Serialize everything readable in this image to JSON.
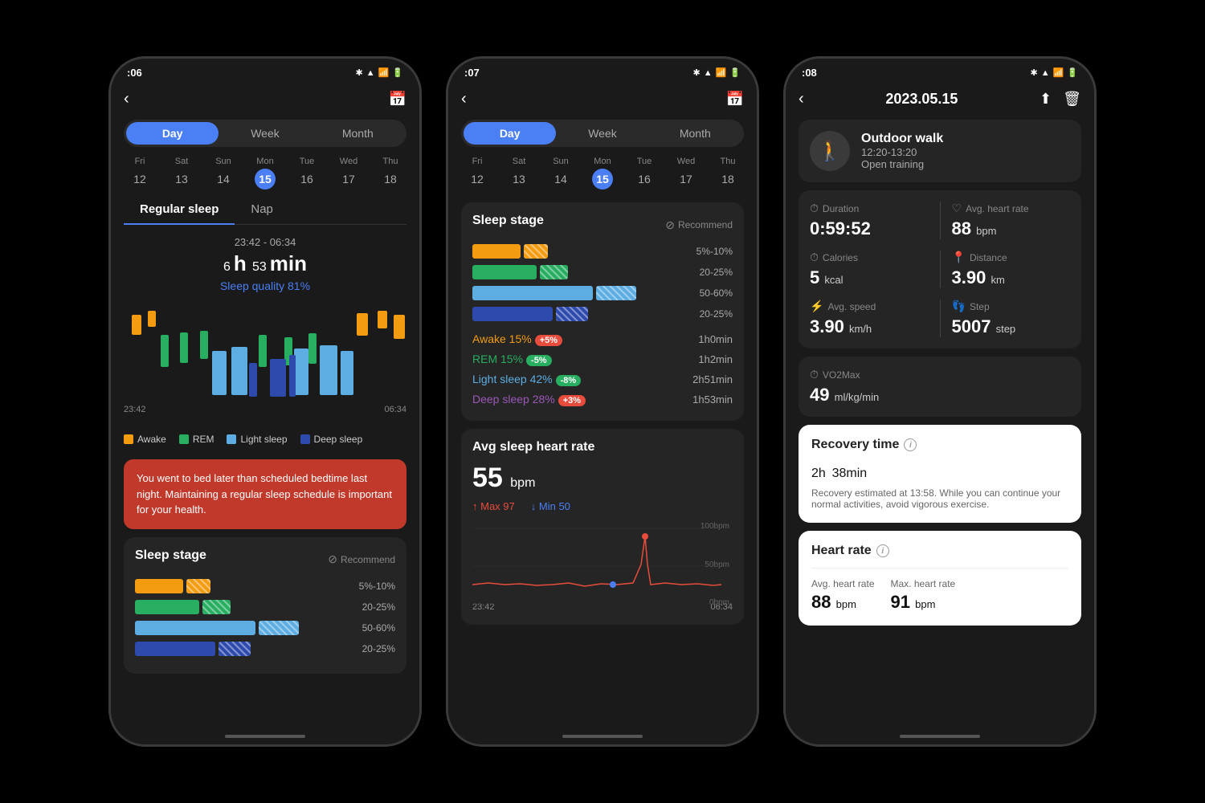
{
  "phone1": {
    "statusBar": {
      "time": ":06",
      "icons": "🔊 📧 🖼️ 📷 • ✱ ▲ 📶 🔋"
    },
    "tabs": [
      "Day",
      "Week",
      "Month"
    ],
    "activeTab": "Day",
    "dates": [
      {
        "day": "Fri",
        "num": "12"
      },
      {
        "day": "Sat",
        "num": "13"
      },
      {
        "day": "Sun",
        "num": "14"
      },
      {
        "day": "Mon",
        "num": "15",
        "today": true
      },
      {
        "day": "Tue",
        "num": "16"
      },
      {
        "day": "Wed",
        "num": "17"
      },
      {
        "day": "Thu",
        "num": "18"
      }
    ],
    "sectionTabs": [
      "Regular sleep",
      "Nap"
    ],
    "activeSectionTab": "Regular sleep",
    "sleepRange": "23:42 - 06:34",
    "sleepHours": "6",
    "sleepMins": "53",
    "sleepQuality": "Sleep quality 81%",
    "chartStartTime": "23:42",
    "chartEndTime": "06:34",
    "legend": [
      {
        "color": "#f39c12",
        "label": "Awake"
      },
      {
        "color": "#27ae60",
        "label": "REM"
      },
      {
        "color": "#5dade2",
        "label": "Light sleep"
      },
      {
        "color": "#2e4aad",
        "label": "Deep sleep"
      }
    ],
    "alertText": "You went to bed later than scheduled bedtime last night. Maintaining a regular sleep schedule is important for your health.",
    "sleepStageTitle": "Sleep stage",
    "recommendLabel": "Recommend",
    "stageRows": [
      {
        "color": "#f39c12",
        "solidWidth": 60,
        "hatchWidth": 30,
        "hatchColor": "#f39c12",
        "pct": "5%-10%"
      },
      {
        "color": "#27ae60",
        "solidWidth": 80,
        "hatchWidth": 35,
        "hatchColor": "#27ae60",
        "pct": "20-25%"
      },
      {
        "color": "#5dade2",
        "solidWidth": 150,
        "hatchWidth": 50,
        "hatchColor": "#5dade2",
        "pct": "50-60%"
      },
      {
        "color": "#2e4aad",
        "solidWidth": 100,
        "hatchWidth": 40,
        "hatchColor": "#2e4aad",
        "pct": "20-25%"
      }
    ]
  },
  "phone2": {
    "statusBar": {
      "time": ":07"
    },
    "tabs": [
      "Day",
      "Week",
      "Month"
    ],
    "dates": [
      {
        "day": "Fri",
        "num": "12"
      },
      {
        "day": "Sat",
        "num": "13"
      },
      {
        "day": "Sun",
        "num": "14"
      },
      {
        "day": "Mon",
        "num": "15",
        "today": true
      },
      {
        "day": "Tue",
        "num": "16"
      },
      {
        "day": "Wed",
        "num": "17"
      },
      {
        "day": "Thu",
        "num": "18"
      }
    ],
    "sleepStageTitle": "Sleep stage",
    "recommendLabel": "Recommend",
    "stageRows": [
      {
        "color": "#f39c12",
        "solidWidth": 60,
        "hatchWidth": 30,
        "pct": "5%-10%"
      },
      {
        "color": "#27ae60",
        "solidWidth": 80,
        "hatchWidth": 35,
        "pct": "20-25%"
      },
      {
        "color": "#5dade2",
        "solidWidth": 150,
        "hatchWidth": 50,
        "pct": "50-60%"
      },
      {
        "color": "#2e4aad",
        "solidWidth": 100,
        "hatchWidth": 40,
        "pct": "20-25%"
      }
    ],
    "stageStats": [
      {
        "label": "Awake",
        "color": "#f39c12",
        "pct": "15%",
        "badge": "+5%",
        "badgeType": "red",
        "time": "1h0min"
      },
      {
        "label": "REM",
        "color": "#27ae60",
        "pct": "15%",
        "badge": "-5%",
        "badgeType": "green",
        "time": "1h2min"
      },
      {
        "label": "Light sleep",
        "color": "#5dade2",
        "pct": "42%",
        "badge": "-8%",
        "badgeType": "green",
        "time": "2h51min"
      },
      {
        "label": "Deep sleep",
        "color": "#2e4aad",
        "pct": "28%",
        "badge": "+3%",
        "badgeType": "red",
        "time": "1h53min"
      }
    ],
    "hrTitle": "Avg sleep heart rate",
    "hrValue": "55",
    "hrUnit": "bpm",
    "hrMax": "97",
    "hrMin": "50",
    "chartStartTime": "23:42",
    "chartEndTime": "06:34",
    "chartLabels": [
      "100bpm",
      "50bpm",
      "0bpm"
    ]
  },
  "phone3": {
    "statusBar": {
      "time": ":08"
    },
    "date": "2023.05.15",
    "workoutName": "Outdoor walk",
    "workoutTimeRange": "12:20-13:20",
    "workoutType": "Open training",
    "duration": "0:59:52",
    "avgHeartRate": "88",
    "avgHeartRateUnit": "bpm",
    "calories": "5",
    "caloriesUnit": "kcal",
    "distance": "3.90",
    "distanceUnit": "km",
    "avgSpeed": "3.90",
    "avgSpeedUnit": "km/h",
    "steps": "5007",
    "stepsUnit": "step",
    "vo2max": "49",
    "vo2maxUnit": "ml/kg/min",
    "recoveryTitle": "Recovery time",
    "recoveryHours": "2",
    "recoveryMins": "38",
    "recoverySubtitle": "Recovery estimated at 13:58. While you can continue your normal activities, avoid vigorous exercise.",
    "heartRateTitle": "Heart rate",
    "avgHRLabel": "Avg. heart rate",
    "maxHRLabel": "Max. heart rate",
    "avgHRValue": "88",
    "maxHRValue": "91",
    "hrUnit": "bpm",
    "labels": {
      "duration": "Duration",
      "avgHeartRate": "Avg. heart rate",
      "calories": "Calories",
      "distance": "Distance",
      "avgSpeed": "Avg. speed",
      "step": "Step",
      "vo2max": "VO2Max"
    }
  }
}
